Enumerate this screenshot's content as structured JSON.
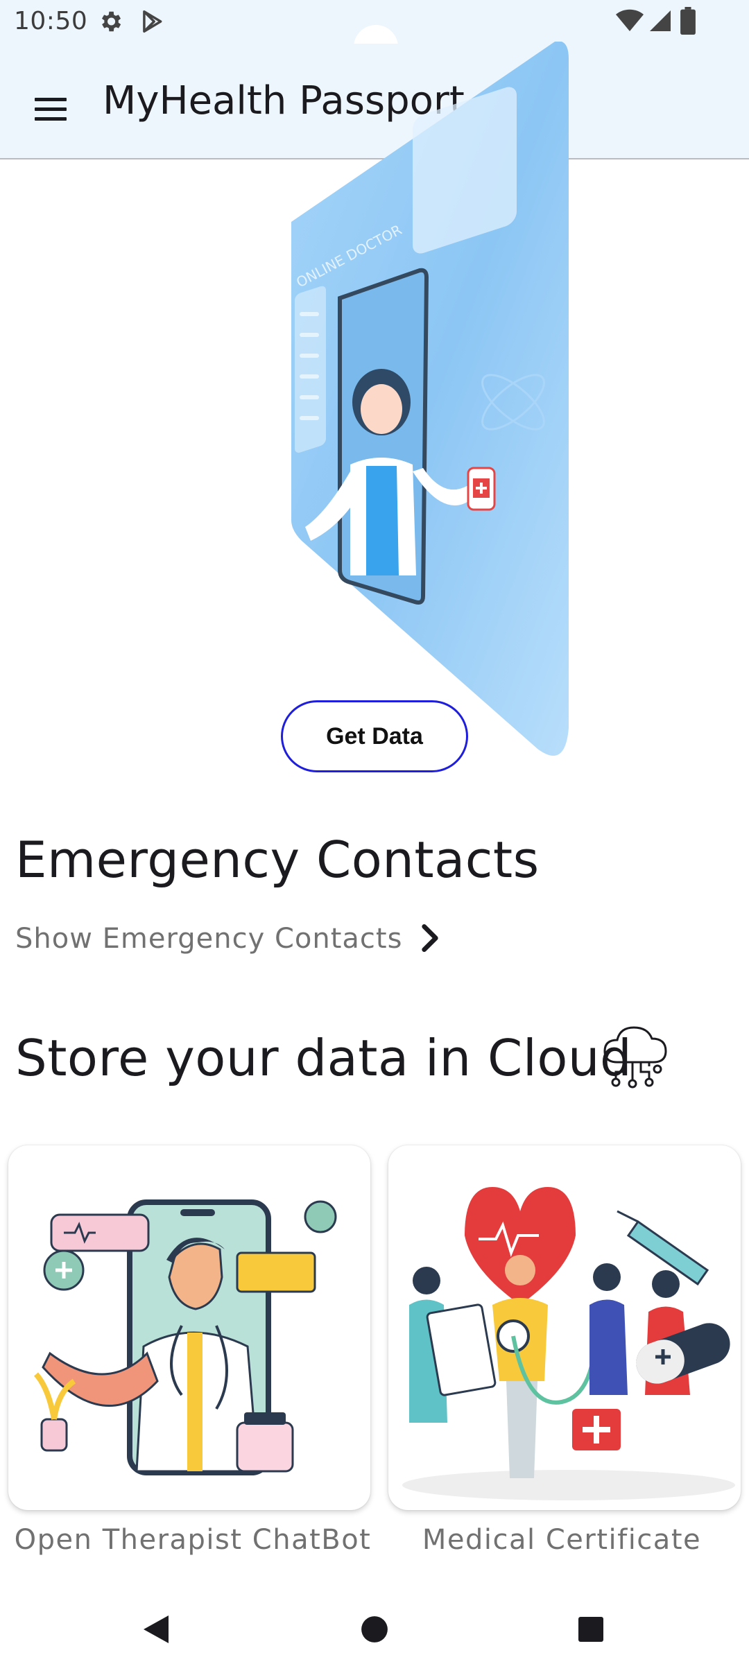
{
  "status_bar": {
    "time": "10:50"
  },
  "app_bar": {
    "title": "MyHealth Passport"
  },
  "hero": {
    "screen_caption": "ONLINE DOCTOR"
  },
  "actions": {
    "get_data_label": "Get Data"
  },
  "emergency": {
    "heading": "Emergency Contacts",
    "show_label": "Show Emergency Contacts"
  },
  "cloud": {
    "heading": "Store your data in Cloud"
  },
  "cards": [
    {
      "label": "Open Therapist ChatBot"
    },
    {
      "label": "Medical Certificate"
    }
  ],
  "colors": {
    "accent": "#1f1fdb",
    "appbar_bg": "#eef6fd",
    "hero_blue": "#8fc8f6"
  },
  "icons": [
    "settings-icon",
    "play-store-icon",
    "wifi-icon",
    "signal-icon",
    "battery-icon",
    "menu-icon",
    "chevron-right-icon",
    "cloud-circuit-icon",
    "back-icon",
    "home-icon",
    "recents-icon"
  ]
}
